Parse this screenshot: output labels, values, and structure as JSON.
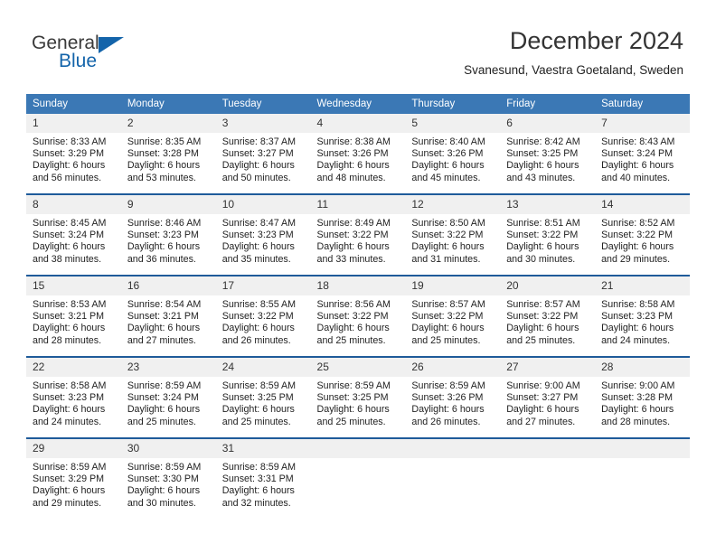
{
  "brand": {
    "name_part1": "General",
    "name_part2": "Blue",
    "accent_color": "#1464aa"
  },
  "header": {
    "title": "December 2024",
    "location": "Svanesund, Vaestra Goetaland, Sweden"
  },
  "calendar": {
    "header_bg": "#3b78b5",
    "row_divider_color": "#1f5b9a",
    "daynum_bg": "#f0f0f0",
    "weekday_headers": [
      "Sunday",
      "Monday",
      "Tuesday",
      "Wednesday",
      "Thursday",
      "Friday",
      "Saturday"
    ],
    "weeks": [
      [
        {
          "day": "1",
          "sunrise": "Sunrise: 8:33 AM",
          "sunset": "Sunset: 3:29 PM",
          "daylight_line1": "Daylight: 6 hours",
          "daylight_line2": "and 56 minutes."
        },
        {
          "day": "2",
          "sunrise": "Sunrise: 8:35 AM",
          "sunset": "Sunset: 3:28 PM",
          "daylight_line1": "Daylight: 6 hours",
          "daylight_line2": "and 53 minutes."
        },
        {
          "day": "3",
          "sunrise": "Sunrise: 8:37 AM",
          "sunset": "Sunset: 3:27 PM",
          "daylight_line1": "Daylight: 6 hours",
          "daylight_line2": "and 50 minutes."
        },
        {
          "day": "4",
          "sunrise": "Sunrise: 8:38 AM",
          "sunset": "Sunset: 3:26 PM",
          "daylight_line1": "Daylight: 6 hours",
          "daylight_line2": "and 48 minutes."
        },
        {
          "day": "5",
          "sunrise": "Sunrise: 8:40 AM",
          "sunset": "Sunset: 3:26 PM",
          "daylight_line1": "Daylight: 6 hours",
          "daylight_line2": "and 45 minutes."
        },
        {
          "day": "6",
          "sunrise": "Sunrise: 8:42 AM",
          "sunset": "Sunset: 3:25 PM",
          "daylight_line1": "Daylight: 6 hours",
          "daylight_line2": "and 43 minutes."
        },
        {
          "day": "7",
          "sunrise": "Sunrise: 8:43 AM",
          "sunset": "Sunset: 3:24 PM",
          "daylight_line1": "Daylight: 6 hours",
          "daylight_line2": "and 40 minutes."
        }
      ],
      [
        {
          "day": "8",
          "sunrise": "Sunrise: 8:45 AM",
          "sunset": "Sunset: 3:24 PM",
          "daylight_line1": "Daylight: 6 hours",
          "daylight_line2": "and 38 minutes."
        },
        {
          "day": "9",
          "sunrise": "Sunrise: 8:46 AM",
          "sunset": "Sunset: 3:23 PM",
          "daylight_line1": "Daylight: 6 hours",
          "daylight_line2": "and 36 minutes."
        },
        {
          "day": "10",
          "sunrise": "Sunrise: 8:47 AM",
          "sunset": "Sunset: 3:23 PM",
          "daylight_line1": "Daylight: 6 hours",
          "daylight_line2": "and 35 minutes."
        },
        {
          "day": "11",
          "sunrise": "Sunrise: 8:49 AM",
          "sunset": "Sunset: 3:22 PM",
          "daylight_line1": "Daylight: 6 hours",
          "daylight_line2": "and 33 minutes."
        },
        {
          "day": "12",
          "sunrise": "Sunrise: 8:50 AM",
          "sunset": "Sunset: 3:22 PM",
          "daylight_line1": "Daylight: 6 hours",
          "daylight_line2": "and 31 minutes."
        },
        {
          "day": "13",
          "sunrise": "Sunrise: 8:51 AM",
          "sunset": "Sunset: 3:22 PM",
          "daylight_line1": "Daylight: 6 hours",
          "daylight_line2": "and 30 minutes."
        },
        {
          "day": "14",
          "sunrise": "Sunrise: 8:52 AM",
          "sunset": "Sunset: 3:22 PM",
          "daylight_line1": "Daylight: 6 hours",
          "daylight_line2": "and 29 minutes."
        }
      ],
      [
        {
          "day": "15",
          "sunrise": "Sunrise: 8:53 AM",
          "sunset": "Sunset: 3:21 PM",
          "daylight_line1": "Daylight: 6 hours",
          "daylight_line2": "and 28 minutes."
        },
        {
          "day": "16",
          "sunrise": "Sunrise: 8:54 AM",
          "sunset": "Sunset: 3:21 PM",
          "daylight_line1": "Daylight: 6 hours",
          "daylight_line2": "and 27 minutes."
        },
        {
          "day": "17",
          "sunrise": "Sunrise: 8:55 AM",
          "sunset": "Sunset: 3:22 PM",
          "daylight_line1": "Daylight: 6 hours",
          "daylight_line2": "and 26 minutes."
        },
        {
          "day": "18",
          "sunrise": "Sunrise: 8:56 AM",
          "sunset": "Sunset: 3:22 PM",
          "daylight_line1": "Daylight: 6 hours",
          "daylight_line2": "and 25 minutes."
        },
        {
          "day": "19",
          "sunrise": "Sunrise: 8:57 AM",
          "sunset": "Sunset: 3:22 PM",
          "daylight_line1": "Daylight: 6 hours",
          "daylight_line2": "and 25 minutes."
        },
        {
          "day": "20",
          "sunrise": "Sunrise: 8:57 AM",
          "sunset": "Sunset: 3:22 PM",
          "daylight_line1": "Daylight: 6 hours",
          "daylight_line2": "and 25 minutes."
        },
        {
          "day": "21",
          "sunrise": "Sunrise: 8:58 AM",
          "sunset": "Sunset: 3:23 PM",
          "daylight_line1": "Daylight: 6 hours",
          "daylight_line2": "and 24 minutes."
        }
      ],
      [
        {
          "day": "22",
          "sunrise": "Sunrise: 8:58 AM",
          "sunset": "Sunset: 3:23 PM",
          "daylight_line1": "Daylight: 6 hours",
          "daylight_line2": "and 24 minutes."
        },
        {
          "day": "23",
          "sunrise": "Sunrise: 8:59 AM",
          "sunset": "Sunset: 3:24 PM",
          "daylight_line1": "Daylight: 6 hours",
          "daylight_line2": "and 25 minutes."
        },
        {
          "day": "24",
          "sunrise": "Sunrise: 8:59 AM",
          "sunset": "Sunset: 3:25 PM",
          "daylight_line1": "Daylight: 6 hours",
          "daylight_line2": "and 25 minutes."
        },
        {
          "day": "25",
          "sunrise": "Sunrise: 8:59 AM",
          "sunset": "Sunset: 3:25 PM",
          "daylight_line1": "Daylight: 6 hours",
          "daylight_line2": "and 25 minutes."
        },
        {
          "day": "26",
          "sunrise": "Sunrise: 8:59 AM",
          "sunset": "Sunset: 3:26 PM",
          "daylight_line1": "Daylight: 6 hours",
          "daylight_line2": "and 26 minutes."
        },
        {
          "day": "27",
          "sunrise": "Sunrise: 9:00 AM",
          "sunset": "Sunset: 3:27 PM",
          "daylight_line1": "Daylight: 6 hours",
          "daylight_line2": "and 27 minutes."
        },
        {
          "day": "28",
          "sunrise": "Sunrise: 9:00 AM",
          "sunset": "Sunset: 3:28 PM",
          "daylight_line1": "Daylight: 6 hours",
          "daylight_line2": "and 28 minutes."
        }
      ],
      [
        {
          "day": "29",
          "sunrise": "Sunrise: 8:59 AM",
          "sunset": "Sunset: 3:29 PM",
          "daylight_line1": "Daylight: 6 hours",
          "daylight_line2": "and 29 minutes."
        },
        {
          "day": "30",
          "sunrise": "Sunrise: 8:59 AM",
          "sunset": "Sunset: 3:30 PM",
          "daylight_line1": "Daylight: 6 hours",
          "daylight_line2": "and 30 minutes."
        },
        {
          "day": "31",
          "sunrise": "Sunrise: 8:59 AM",
          "sunset": "Sunset: 3:31 PM",
          "daylight_line1": "Daylight: 6 hours",
          "daylight_line2": "and 32 minutes."
        },
        {
          "day": "",
          "sunrise": "",
          "sunset": "",
          "daylight_line1": "",
          "daylight_line2": ""
        },
        {
          "day": "",
          "sunrise": "",
          "sunset": "",
          "daylight_line1": "",
          "daylight_line2": ""
        },
        {
          "day": "",
          "sunrise": "",
          "sunset": "",
          "daylight_line1": "",
          "daylight_line2": ""
        },
        {
          "day": "",
          "sunrise": "",
          "sunset": "",
          "daylight_line1": "",
          "daylight_line2": ""
        }
      ]
    ]
  }
}
